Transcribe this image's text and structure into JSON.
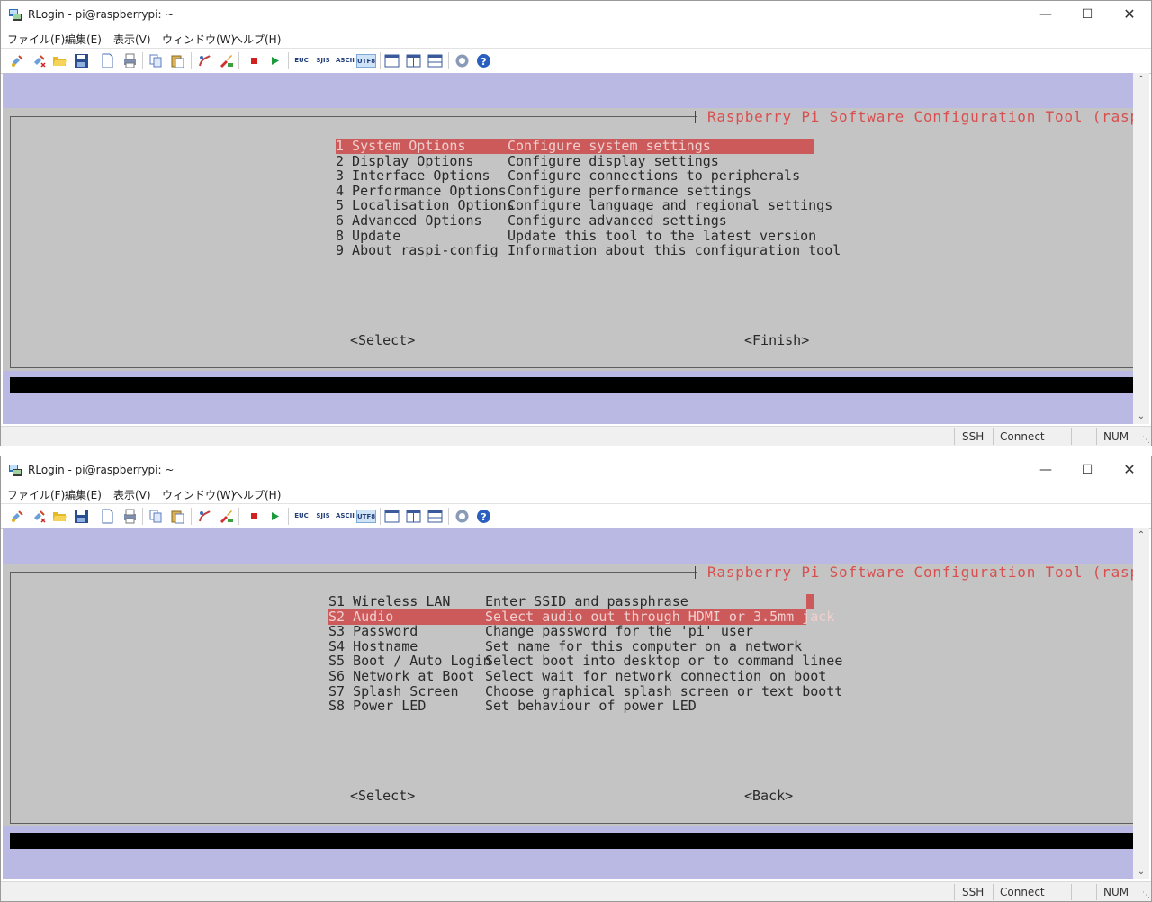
{
  "window1": {
    "title": "RLogin - pi@raspberrypi: ~",
    "menu": [
      "ファイル(F)",
      "編集(E)",
      "表示(V)",
      "ウィンドウ(W)",
      "ヘルプ(H)"
    ],
    "toolbar_text_buttons": [
      "EUC",
      "SJIS",
      "ASCII",
      "UTF8"
    ],
    "dialog_title": "Raspberry Pi Software Configuration Tool (raspi-config)",
    "menu_rows": [
      {
        "key": "1 System Options",
        "desc": "Configure system settings"
      },
      {
        "key": "2 Display Options",
        "desc": "Configure display settings"
      },
      {
        "key": "3 Interface Options",
        "desc": "Configure connections to peripherals"
      },
      {
        "key": "4 Performance Options",
        "desc": "Configure performance settings"
      },
      {
        "key": "5 Localisation Options",
        "desc": "Configure language and regional settings"
      },
      {
        "key": "6 Advanced Options",
        "desc": "Configure advanced settings"
      },
      {
        "key": "8 Update",
        "desc": "Update this tool to the latest version"
      },
      {
        "key": "9 About raspi-config",
        "desc": "Information about this configuration tool"
      }
    ],
    "selected_index": 0,
    "buttons": {
      "left": "<Select>",
      "right": "<Finish>"
    },
    "status": {
      "protocol": "SSH",
      "state": "Connect",
      "numlock": "NUM"
    }
  },
  "window2": {
    "title": "RLogin - pi@raspberrypi: ~",
    "menu": [
      "ファイル(F)",
      "編集(E)",
      "表示(V)",
      "ウィンドウ(W)",
      "ヘルプ(H)"
    ],
    "toolbar_text_buttons": [
      "EUC",
      "SJIS",
      "ASCII",
      "UTF8"
    ],
    "dialog_title": "Raspberry Pi Software Configuration Tool (raspi-config)",
    "menu_rows": [
      {
        "key": "S1 Wireless LAN",
        "desc": "Enter SSID and passphrase"
      },
      {
        "key": "S2 Audio",
        "desc": "Select audio out through HDMI or 3.5mm jack"
      },
      {
        "key": "S3 Password",
        "desc": "Change password for the 'pi' user"
      },
      {
        "key": "S4 Hostname",
        "desc": "Set name for this computer on a network"
      },
      {
        "key": "S5 Boot / Auto Login",
        "desc": "Select boot into desktop or to command linee"
      },
      {
        "key": "S6 Network at Boot",
        "desc": "Select wait for network connection on boot"
      },
      {
        "key": "S7 Splash Screen",
        "desc": "Choose graphical splash screen or text boott"
      },
      {
        "key": "S8 Power LED",
        "desc": "Set behaviour of power LED"
      }
    ],
    "selected_index": 1,
    "buttons": {
      "left": "<Select>",
      "right": "<Back>"
    },
    "status": {
      "protocol": "SSH",
      "state": "Connect",
      "numlock": "NUM"
    }
  },
  "colors": {
    "terminal_bg": "#b9b9e4",
    "dialog_bg": "#c4c4c4",
    "highlight": "#cd5a5a",
    "title_text": "#d94f4f"
  }
}
